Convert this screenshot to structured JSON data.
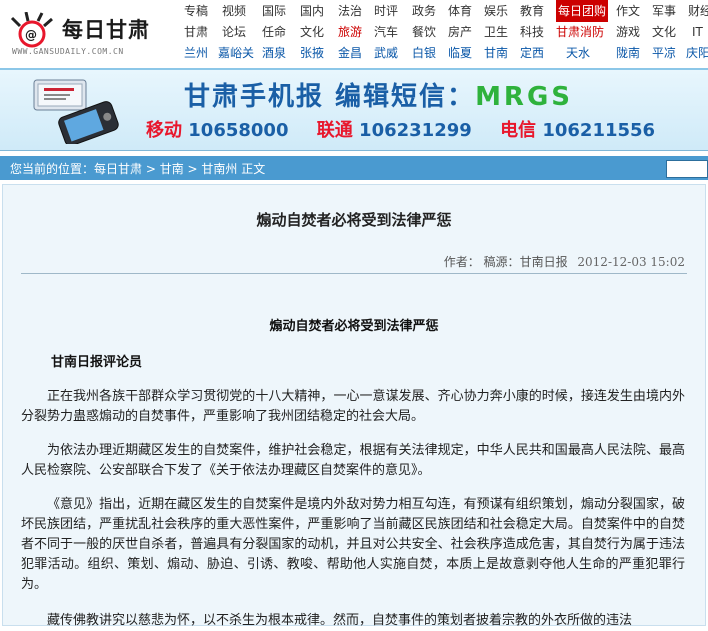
{
  "site": {
    "logo_brand": "每日甘肃",
    "logo_url": "WWW.GANSUDAILY.COM.CN"
  },
  "nav": {
    "row1": [
      "专稿",
      "视频",
      "国际",
      "国内",
      "法治",
      "时评",
      "政务",
      "体育",
      "娱乐",
      "教育",
      "每日团购",
      "作文",
      "军事",
      "财经"
    ],
    "row2": [
      "甘肃",
      "论坛",
      "任命",
      "文化",
      "旅游",
      "汽车",
      "餐饮",
      "房产",
      "卫生",
      "科技",
      "甘肃消防",
      "游戏",
      "文化",
      "IT"
    ],
    "row3": [
      "兰州",
      "嘉峪关",
      "酒泉",
      "张掖",
      "金昌",
      "武威",
      "白银",
      "临夏",
      "甘南",
      "定西",
      "天水",
      "陇南",
      "平凉",
      "庆阳"
    ],
    "highlight_color": "#cc0000",
    "link_color": "#0a57a8"
  },
  "banner": {
    "line1_text": "甘肃手机报  编辑短信：",
    "line1_code": "MRGS",
    "op1": "移动",
    "num1": "10658000",
    "op2": "联通",
    "num2": "106231299",
    "op3": "电信",
    "num3": "106211556"
  },
  "breadcrumb": {
    "prefix": "您当前的位置：",
    "items": [
      "每日甘肃",
      "甘南",
      "甘南州 正文"
    ],
    "separator": " > "
  },
  "article": {
    "title": "煽动自焚者必将受到法律严惩",
    "author_label": "作者：",
    "source_label": "稿源：",
    "source": "甘南日报",
    "date": "2012-12-03 15:02",
    "subtitle": "煽动自焚者必将受到法律严惩",
    "byline": "甘南日报评论员",
    "paragraphs": [
      "正在我州各族干部群众学习贯彻党的十八大精神，一心一意谋发展、齐心协力奔小康的时候，接连发生由境内外分裂势力蛊惑煽动的自焚事件，严重影响了我州团结稳定的社会大局。",
      "为依法办理近期藏区发生的自焚案件，维护社会稳定，根据有关法律规定，中华人民共和国最高人民法院、最高人民检察院、公安部联合下发了《关于依法办理藏区自焚案件的意见》。",
      "《意见》指出，近期在藏区发生的自焚案件是境内外敌对势力相互勾连，有预谋有组织策划，煽动分裂国家，破坏民族团结，严重扰乱社会秩序的重大恶性案件，严重影响了当前藏区民族团结和社会稳定大局。自焚案件中的自焚者不同于一般的厌世自杀者，普遍具有分裂国家的动机，并且对公共安全、社会秩序造成危害，其自焚行为属于违法犯罪活动。组织、策划、煽动、胁迫、引诱、教唆、帮助他人实施自焚，本质上是故意剥夺他人生命的严重犯罪行为。",
      "藏传佛教讲究以慈悲为怀，以不杀生为根本戒律。然而，自焚事件的策划者披着宗教的外衣所做的违法"
    ]
  },
  "colors": {
    "crumb_bar": "#4a9ad0",
    "article_bg": "#eef6fb",
    "banner_green": "#2fb23c",
    "banner_blue": "#1a5fa6",
    "banner_red": "#e8172c"
  }
}
